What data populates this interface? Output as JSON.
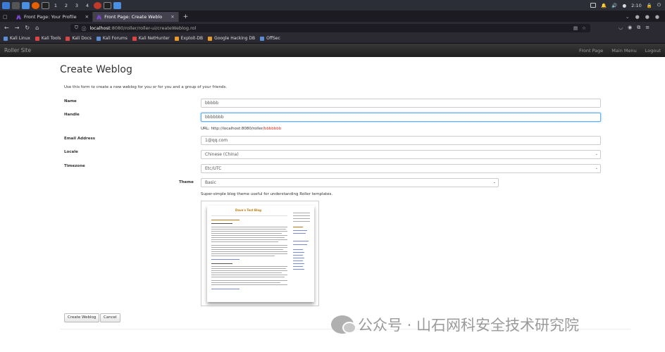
{
  "taskbar": {
    "workspaces": [
      "1",
      "2",
      "3",
      "4"
    ],
    "time": "2:10"
  },
  "tabs": [
    {
      "label": "Front Page: Your Profile",
      "active": false
    },
    {
      "label": "Front Page: Create Weblo",
      "active": true
    }
  ],
  "url": {
    "host": "localhost",
    "path": ":8080/roller/roller-ui/createWeblog.rol"
  },
  "bookmarks": [
    "Kali Linux",
    "Kali Tools",
    "Kali Docs",
    "Kali Forums",
    "Kali NetHunter",
    "Exploit-DB",
    "Google Hacking DB",
    "OffSec"
  ],
  "app": {
    "brand": "Roller Site",
    "links": [
      "Front Page",
      "Main Menu",
      "Logout"
    ]
  },
  "form": {
    "title": "Create Weblog",
    "intro": "Use this form to create a new weblog for you or for you and a group of your friends.",
    "name_label": "Name",
    "name_value": "bbbbb",
    "handle_label": "Handle",
    "handle_value": "bbbbbbb",
    "url_prefix": "URL:  http://localhost:8080/roller/",
    "url_handle": "bbbbbbb",
    "email_label": "Email Address",
    "email_value": "1@qq.com",
    "locale_label": "Locale",
    "locale_value": "Chinese (China)",
    "timezone_label": "Timezone",
    "timezone_value": "Etc/UTC",
    "theme_label": "Theme",
    "theme_value": "Basic",
    "theme_desc": "Super-simple blog theme useful for understanding Roller templates.",
    "preview_title": "Dave's Test Blog",
    "create_button": "Create Weblog",
    "cancel_button": "Cancel"
  },
  "watermark": "公众号 · 山石网科安全技术研究院"
}
